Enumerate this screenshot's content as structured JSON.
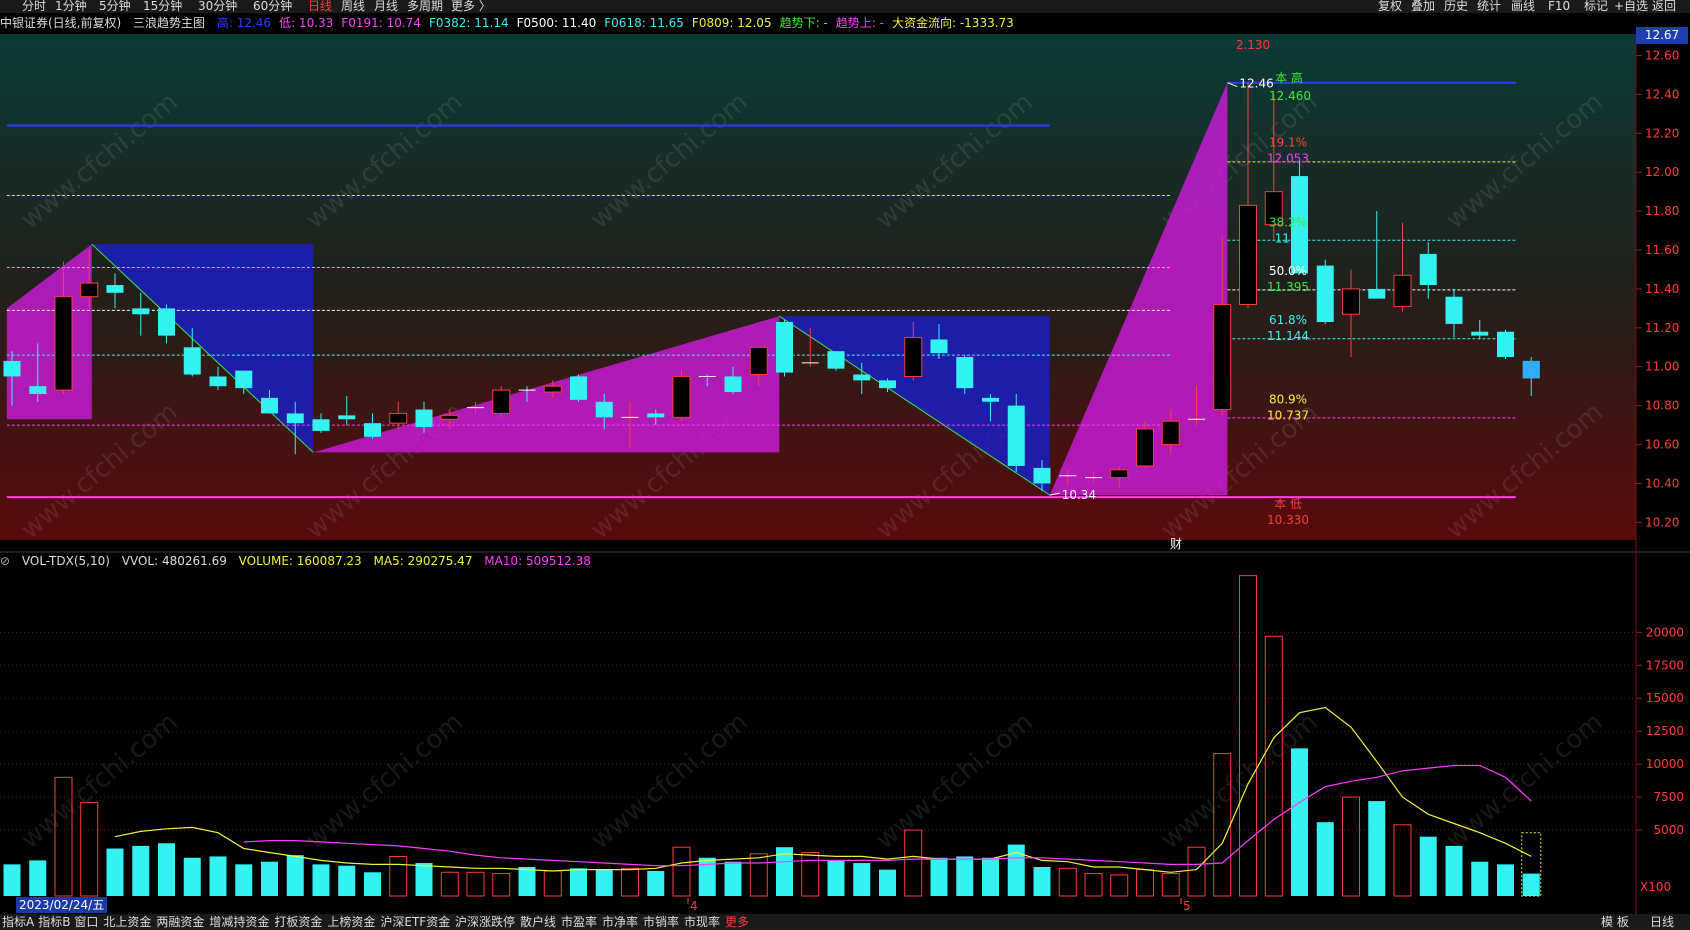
{
  "top_bar": {
    "periods": [
      {
        "label": "分时",
        "active": false
      },
      {
        "label": "1分钟",
        "active": false
      },
      {
        "label": "5分钟",
        "active": false
      },
      {
        "label": "15分钟",
        "active": false
      },
      {
        "label": "30分钟",
        "active": false
      },
      {
        "label": "60分钟",
        "active": false
      },
      {
        "label": "日线",
        "active": true
      },
      {
        "label": "周线",
        "active": false
      },
      {
        "label": "月线",
        "active": false
      },
      {
        "label": "多周期",
        "active": false
      },
      {
        "label": "更多 〉",
        "active": false
      }
    ],
    "tools": [
      "复权",
      "叠加",
      "历史",
      "统计",
      "画线",
      "F10",
      "标记",
      "+自选",
      "返回"
    ]
  },
  "info_line": {
    "title": "中银证券(日线,前复权)",
    "indicator": "三浪趋势主图",
    "items": [
      {
        "text": "高: 12.46",
        "color": "#2a3cff"
      },
      {
        "text": "低: 10.33",
        "color": "#ff3bff"
      },
      {
        "text": "F0191: 10.74",
        "color": "#ff3bff"
      },
      {
        "text": "F0382: 11.14",
        "color": "#35f2f2"
      },
      {
        "text": "F0500: 11.40",
        "color": "#ffffff"
      },
      {
        "text": "F0618: 11.65",
        "color": "#35f2f2"
      },
      {
        "text": "F0809: 12.05",
        "color": "#f2f23a"
      },
      {
        "text": "趋势下: -",
        "color": "#3ae83a"
      },
      {
        "text": "趋势上: -",
        "color": "#ff3bff"
      },
      {
        "text": "大资金流向: -1333.73",
        "color": "#f2f23a"
      }
    ],
    "last_price": "12.67"
  },
  "price_axis": {
    "ticks": [
      "12.60",
      "12.40",
      "12.20",
      "12.00",
      "11.80",
      "11.60",
      "11.40",
      "11.20",
      "11.00",
      "10.80",
      "10.60",
      "10.40",
      "10.20"
    ]
  },
  "annotations": {
    "top_label": "2.130",
    "high_text": "本 高",
    "high_value": "12.460",
    "high_arrow": "12.46",
    "fib": [
      {
        "pct": "19.1%",
        "value": "12.053",
        "pct_color": "#ff4040",
        "val_color": "#ff3bff"
      },
      {
        "pct": "38.2%",
        "value": "11.6",
        "pct_color": "#3ae83a",
        "val_color": "#35f2f2"
      },
      {
        "pct": "50.0%",
        "value": "11.395",
        "pct_color": "#ffffff",
        "val_color": "#3ae83a"
      },
      {
        "pct": "61.8%",
        "value": "11.144",
        "pct_color": "#35f2f2",
        "val_color": "#35f2f2"
      },
      {
        "pct": "80.9%",
        "value": "10.737",
        "pct_color": "#f2f23a",
        "val_color": "#f2f23a"
      }
    ],
    "low_text": "本 低",
    "low_value": "10.330",
    "low_arrow": "10.34",
    "fin_mark": "财"
  },
  "vol_info": {
    "name": "VOL-TDX(5,10)",
    "vvol": "VVOL: 480261.69",
    "volume": "VOLUME: 160087.23",
    "ma5": "MA5: 290275.47",
    "ma10": "MA10: 509512.38"
  },
  "vol_axis": {
    "ticks": [
      "20000",
      "17500",
      "15000",
      "12500",
      "10000",
      "7500",
      "5000"
    ],
    "unit": "X100"
  },
  "x_axis": {
    "date": "2023/02/24/五",
    "month_marks": [
      "4",
      "5"
    ]
  },
  "bottom_bar": {
    "items": [
      {
        "label": "指标A",
        "active": false
      },
      {
        "label": "指标B",
        "active": false
      },
      {
        "label": "窗口",
        "active": false
      },
      {
        "label": "北上资金",
        "active": false
      },
      {
        "label": "两融资金",
        "active": false
      },
      {
        "label": "增减持资金",
        "active": false
      },
      {
        "label": "打板资金",
        "active": false
      },
      {
        "label": "上榜资金",
        "active": false
      },
      {
        "label": "沪深ETF资金",
        "active": false
      },
      {
        "label": "沪深涨跌停",
        "active": false
      },
      {
        "label": "散户线",
        "active": false
      },
      {
        "label": "市盈率",
        "active": false
      },
      {
        "label": "市净率",
        "active": false
      },
      {
        "label": "市销率",
        "active": false
      },
      {
        "label": "市现率",
        "active": false
      },
      {
        "label": "更多",
        "active": true
      }
    ],
    "right": [
      "模 板",
      "日线"
    ]
  },
  "watermark": "www.cfchi.com",
  "colors": {
    "up": "#ff3b3b",
    "down": "#35f2f2",
    "magenta": "#c51bd1",
    "blue": "#1a1fc4",
    "ma5": "#f2f23a",
    "ma10": "#ff3bff"
  },
  "chart_data": {
    "type": "candlestick",
    "price_ylim": [
      10.13,
      12.7
    ],
    "candles": [
      {
        "o": 11.03,
        "h": 11.08,
        "l": 10.8,
        "c": 10.95
      },
      {
        "o": 10.9,
        "h": 11.12,
        "l": 10.82,
        "c": 10.86
      },
      {
        "o": 10.88,
        "h": 11.54,
        "l": 10.86,
        "c": 11.36
      },
      {
        "o": 11.36,
        "h": 11.6,
        "l": 11.3,
        "c": 11.43
      },
      {
        "o": 11.42,
        "h": 11.48,
        "l": 11.3,
        "c": 11.38
      },
      {
        "o": 11.3,
        "h": 11.38,
        "l": 11.16,
        "c": 11.27
      },
      {
        "o": 11.3,
        "h": 11.32,
        "l": 11.12,
        "c": 11.16
      },
      {
        "o": 11.1,
        "h": 11.2,
        "l": 10.95,
        "c": 10.96
      },
      {
        "o": 10.95,
        "h": 11.0,
        "l": 10.88,
        "c": 10.9
      },
      {
        "o": 10.98,
        "h": 10.98,
        "l": 10.86,
        "c": 10.89
      },
      {
        "o": 10.84,
        "h": 10.88,
        "l": 10.76,
        "c": 10.76
      },
      {
        "o": 10.76,
        "h": 10.82,
        "l": 10.55,
        "c": 10.71
      },
      {
        "o": 10.73,
        "h": 10.76,
        "l": 10.66,
        "c": 10.67
      },
      {
        "o": 10.75,
        "h": 10.85,
        "l": 10.7,
        "c": 10.73
      },
      {
        "o": 10.71,
        "h": 10.76,
        "l": 10.63,
        "c": 10.64
      },
      {
        "o": 10.71,
        "h": 10.82,
        "l": 10.68,
        "c": 10.76
      },
      {
        "o": 10.78,
        "h": 10.82,
        "l": 10.66,
        "c": 10.69
      },
      {
        "o": 10.73,
        "h": 10.78,
        "l": 10.68,
        "c": 10.75
      },
      {
        "o": 10.79,
        "h": 10.82,
        "l": 10.76,
        "c": 10.79
      },
      {
        "o": 10.76,
        "h": 10.9,
        "l": 10.74,
        "c": 10.88
      },
      {
        "o": 10.88,
        "h": 10.9,
        "l": 10.82,
        "c": 10.87
      },
      {
        "o": 10.87,
        "h": 10.93,
        "l": 10.84,
        "c": 10.9
      },
      {
        "o": 10.95,
        "h": 10.96,
        "l": 10.82,
        "c": 10.83
      },
      {
        "o": 10.82,
        "h": 10.86,
        "l": 10.68,
        "c": 10.74
      },
      {
        "o": 10.74,
        "h": 10.82,
        "l": 10.58,
        "c": 10.74
      },
      {
        "o": 10.76,
        "h": 10.78,
        "l": 10.7,
        "c": 10.74
      },
      {
        "o": 10.74,
        "h": 10.98,
        "l": 10.72,
        "c": 10.95
      },
      {
        "o": 10.95,
        "h": 10.96,
        "l": 10.9,
        "c": 10.94
      },
      {
        "o": 10.95,
        "h": 11.0,
        "l": 10.86,
        "c": 10.87
      },
      {
        "o": 10.96,
        "h": 11.1,
        "l": 10.9,
        "c": 11.1
      },
      {
        "o": 11.23,
        "h": 11.24,
        "l": 10.95,
        "c": 10.97
      },
      {
        "o": 11.02,
        "h": 11.2,
        "l": 11.0,
        "c": 11.02
      },
      {
        "o": 11.08,
        "h": 11.08,
        "l": 10.98,
        "c": 10.99
      },
      {
        "o": 10.96,
        "h": 11.02,
        "l": 10.86,
        "c": 10.93
      },
      {
        "o": 10.93,
        "h": 10.94,
        "l": 10.87,
        "c": 10.89
      },
      {
        "o": 10.95,
        "h": 11.23,
        "l": 10.93,
        "c": 11.15
      },
      {
        "o": 11.14,
        "h": 11.22,
        "l": 11.04,
        "c": 11.07
      },
      {
        "o": 11.05,
        "h": 11.06,
        "l": 10.86,
        "c": 10.89
      },
      {
        "o": 10.84,
        "h": 10.86,
        "l": 10.72,
        "c": 10.82
      },
      {
        "o": 10.8,
        "h": 10.86,
        "l": 10.46,
        "c": 10.49
      },
      {
        "o": 10.48,
        "h": 10.52,
        "l": 10.36,
        "c": 10.4
      },
      {
        "o": 10.44,
        "h": 10.47,
        "l": 10.39,
        "c": 10.44
      },
      {
        "o": 10.43,
        "h": 10.46,
        "l": 10.41,
        "c": 10.43
      },
      {
        "o": 10.43,
        "h": 10.49,
        "l": 10.38,
        "c": 10.47
      },
      {
        "o": 10.49,
        "h": 10.72,
        "l": 10.48,
        "c": 10.68
      },
      {
        "o": 10.6,
        "h": 10.78,
        "l": 10.55,
        "c": 10.72
      },
      {
        "o": 10.72,
        "h": 10.9,
        "l": 10.7,
        "c": 10.73
      },
      {
        "o": 10.78,
        "h": 11.67,
        "l": 10.75,
        "c": 11.32
      },
      {
        "o": 11.32,
        "h": 12.46,
        "l": 11.3,
        "c": 11.83
      },
      {
        "o": 11.73,
        "h": 12.4,
        "l": 11.65,
        "c": 11.9
      },
      {
        "o": 11.98,
        "h": 12.05,
        "l": 11.48,
        "c": 11.48
      },
      {
        "o": 11.52,
        "h": 11.55,
        "l": 11.22,
        "c": 11.23
      },
      {
        "o": 11.27,
        "h": 11.5,
        "l": 11.05,
        "c": 11.4
      },
      {
        "o": 11.4,
        "h": 11.8,
        "l": 11.35,
        "c": 11.35
      },
      {
        "o": 11.31,
        "h": 11.74,
        "l": 11.28,
        "c": 11.47
      },
      {
        "o": 11.58,
        "h": 11.64,
        "l": 11.35,
        "c": 11.42
      },
      {
        "o": 11.36,
        "h": 11.4,
        "l": 11.15,
        "c": 11.22
      },
      {
        "o": 11.18,
        "h": 11.24,
        "l": 11.14,
        "c": 11.16
      },
      {
        "o": 11.18,
        "h": 11.19,
        "l": 11.04,
        "c": 11.05
      },
      {
        "o": 11.03,
        "h": 11.05,
        "l": 10.85,
        "c": 10.94
      }
    ],
    "volume_ylim": [
      0,
      24500
    ],
    "volumes": [
      2400,
      2700,
      9000,
      7100,
      3600,
      3800,
      4000,
      2900,
      3000,
      2400,
      2600,
      3100,
      2400,
      2300,
      1800,
      3000,
      2500,
      1800,
      1800,
      1700,
      2200,
      1900,
      2100,
      2000,
      2100,
      1900,
      3700,
      2900,
      2600,
      3200,
      3700,
      3300,
      2700,
      2500,
      2000,
      5000,
      2900,
      3000,
      2900,
      3900,
      2200,
      2100,
      1700,
      1600,
      2000,
      1700,
      3700,
      10800,
      24300,
      19700,
      11200,
      5600,
      7500,
      7200,
      5400,
      4500,
      3800,
      2600,
      2400,
      1700
    ],
    "ma5": [
      null,
      null,
      null,
      null,
      4500,
      4900,
      5100,
      5200,
      4800,
      3600,
      3300,
      3000,
      2700,
      2500,
      2400,
      2400,
      2300,
      2200,
      2100,
      2100,
      2000,
      1900,
      2000,
      2000,
      2000,
      2100,
      2500,
      2700,
      2800,
      2900,
      3200,
      3100,
      3000,
      3000,
      2800,
      3000,
      2800,
      2800,
      2800,
      3300,
      2700,
      2600,
      2200,
      2200,
      2000,
      1800,
      2000,
      4000,
      8500,
      12000,
      13900,
      14300,
      12800,
      10200,
      7500,
      6200,
      5500,
      4800,
      4000,
      3000
    ],
    "ma10": [
      null,
      null,
      null,
      null,
      null,
      null,
      null,
      null,
      null,
      4100,
      4200,
      4200,
      4100,
      4000,
      3900,
      3800,
      3600,
      3400,
      3100,
      2900,
      2800,
      2700,
      2600,
      2500,
      2400,
      2300,
      2300,
      2400,
      2500,
      2500,
      2600,
      2700,
      2700,
      2700,
      2700,
      2800,
      2800,
      2800,
      2800,
      2900,
      2900,
      2800,
      2700,
      2600,
      2500,
      2400,
      2400,
      2500,
      4200,
      5800,
      7100,
      8300,
      8700,
      9000,
      9500,
      9700,
      9900,
      9900,
      9000,
      7200
    ]
  }
}
